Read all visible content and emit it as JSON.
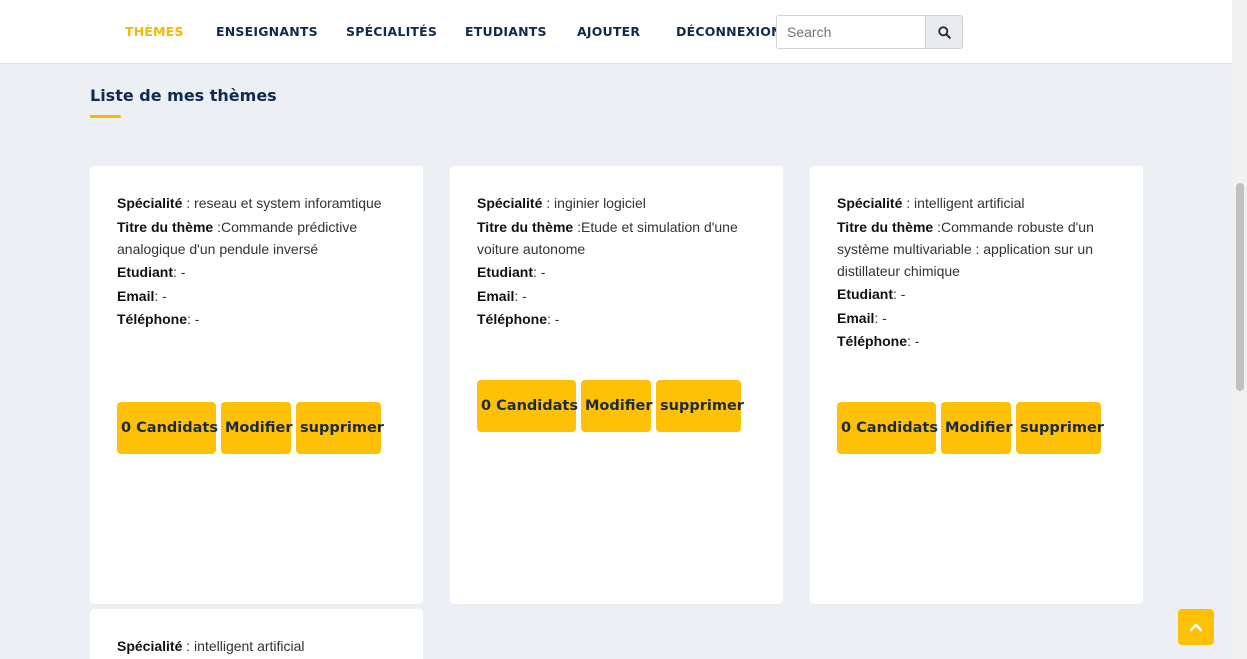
{
  "nav": {
    "items": [
      {
        "label": "THÈMES",
        "active": true
      },
      {
        "label": "ENSEIGNANTS",
        "active": false
      },
      {
        "label": "SPÉCIALITÉS",
        "active": false
      },
      {
        "label": "ETUDIANTS",
        "active": false
      },
      {
        "label": "AJOUTER",
        "active": false
      },
      {
        "label": "DÉCONNEXION",
        "active": false
      }
    ],
    "search_placeholder": "Search",
    "search_icon": "search-icon"
  },
  "page": {
    "title": "Liste de mes thèmes"
  },
  "labels": {
    "specialite": "Spécialité",
    "titre": "Titre du thème",
    "etudiant": "Etudiant",
    "email": "Email",
    "telephone": "Téléphone"
  },
  "cards": [
    {
      "specialite": " : reseau et system inforamtique",
      "titre": " :Commande prédictive analogique d'un pendule inversé",
      "etudiant": ": -",
      "email": ": -",
      "telephone": ": -",
      "buttons": {
        "candidats": "0 Candidats",
        "modifier": "Modifier",
        "supprimer": "supprimer"
      }
    },
    {
      "specialite": " : inginier logiciel",
      "titre": " :Etude et simulation d'une voiture autonome",
      "etudiant": ": -",
      "email": ": -",
      "telephone": ": -",
      "buttons": {
        "candidats": "0 Candidats",
        "modifier": "Modifier",
        "supprimer": "supprimer"
      }
    },
    {
      "specialite": " : intelligent artificial",
      "titre": " :Commande robuste d'un système multivariable : application sur un distillateur chimique",
      "etudiant": ": -",
      "email": ": -",
      "telephone": ": -",
      "buttons": {
        "candidats": "0 Candidats",
        "modifier": "Modifier",
        "supprimer": "supprimer"
      }
    },
    {
      "specialite": " : intelligent artificial"
    }
  ],
  "colors": {
    "accent": "#ffc107",
    "active_nav": "#f5b800",
    "nav_text": "#0f2a4d",
    "background": "#eceff3"
  }
}
